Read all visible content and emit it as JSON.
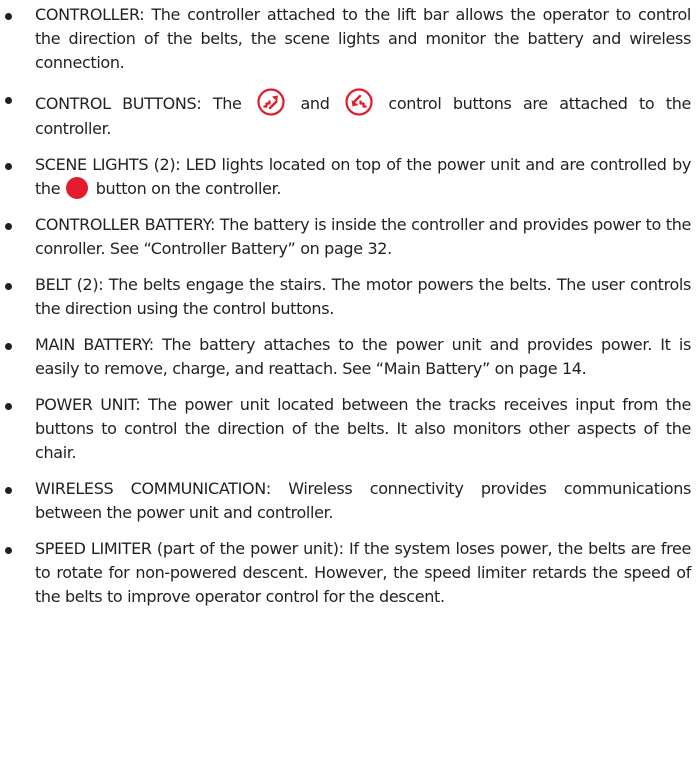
{
  "items": [
    {
      "text": "CONTROLLER: The controller attached to the lift bar allows the operator to control the direction of the belts, the scene lights and monitor the battery and wireless connection."
    },
    {
      "before": "CONTROL BUTTONS: The",
      "middle": "and",
      "after": "control buttons are attached to the controller.",
      "icon_up": "stair-climb-up-icon",
      "icon_down": "stair-descend-icon",
      "icon_color": "#e31b2e"
    },
    {
      "before": "SCENE LIGHTS (2): LED lights located on top of the power unit and are controlled by the",
      "after": "button on the controller.",
      "icon": "red-circle-button-icon",
      "icon_color": "#e31b2e"
    },
    {
      "text": "CONTROLLER BATTERY: The battery is inside the controller and provides power to the conroller. See “Controller Battery” on page 32."
    },
    {
      "text": "BELT (2): The belts engage the stairs. The motor powers the belts. The user controls the direction using the control buttons."
    },
    {
      "text": "MAIN BATTERY: The battery attaches to the power unit and provides power. It is easily to remove, charge, and reattach. See “Main Battery” on page 14."
    },
    {
      "text": "POWER UNIT: The power unit located between the tracks receives input from the buttons to control the direction of the belts. It also monitors other aspects of the chair."
    },
    {
      "text": "WIRELESS COMMUNICATION: Wireless connectivity provides communications between the power unit and controller."
    },
    {
      "text": "SPEED LIMITER (part of the power unit): If the system loses power, the belts are free to rotate for non-powered descent. However, the speed limiter retards the speed of the belts to improve operator control for the descent."
    }
  ]
}
